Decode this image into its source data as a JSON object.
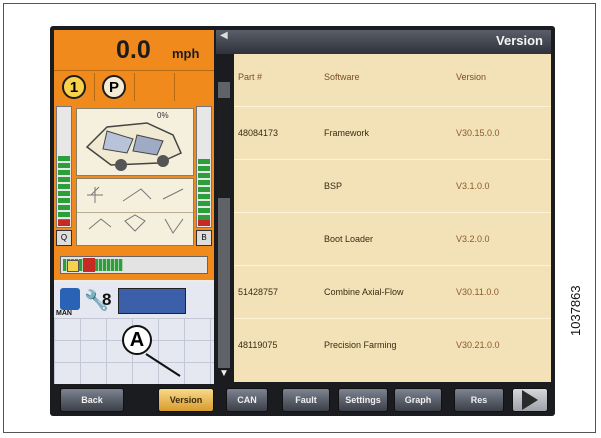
{
  "speed": {
    "value": "0.0",
    "unit": "mph"
  },
  "status": {
    "gear": "1",
    "park": "P"
  },
  "combine": {
    "percent": "0%"
  },
  "bottom_status": {
    "count": "8",
    "mode": "MAN"
  },
  "panel": {
    "title": "Version"
  },
  "table": {
    "headers": [
      "Part #",
      "Software",
      "Version"
    ],
    "rows": [
      {
        "part": "48084173",
        "software": "Framework",
        "version": "V30.15.0.0"
      },
      {
        "part": "",
        "software": "BSP",
        "version": "V3.1.0.0"
      },
      {
        "part": "",
        "software": "Boot Loader",
        "version": "V3.2.0.0"
      },
      {
        "part": "51428757",
        "software": "Combine Axial-Flow",
        "version": "V30.11.0.0"
      },
      {
        "part": "48119075",
        "software": "Precision Farming",
        "version": "V30.21.0.0"
      }
    ]
  },
  "buttons": {
    "back": "Back",
    "version": "Version",
    "can": "CAN",
    "fault": "Fault",
    "settings": "Settings",
    "graph": "Graph",
    "res": "Res"
  },
  "callout": "A",
  "figure_id": "1037863",
  "colors": {
    "accent": "#f08a1c",
    "table_bg": "#f3e2b8",
    "version_btn": "#d89c2e"
  },
  "icons": {
    "next": "play-arrow-icon",
    "wrench": "wrench-icon",
    "scroll_down": "down-arrow-icon"
  }
}
